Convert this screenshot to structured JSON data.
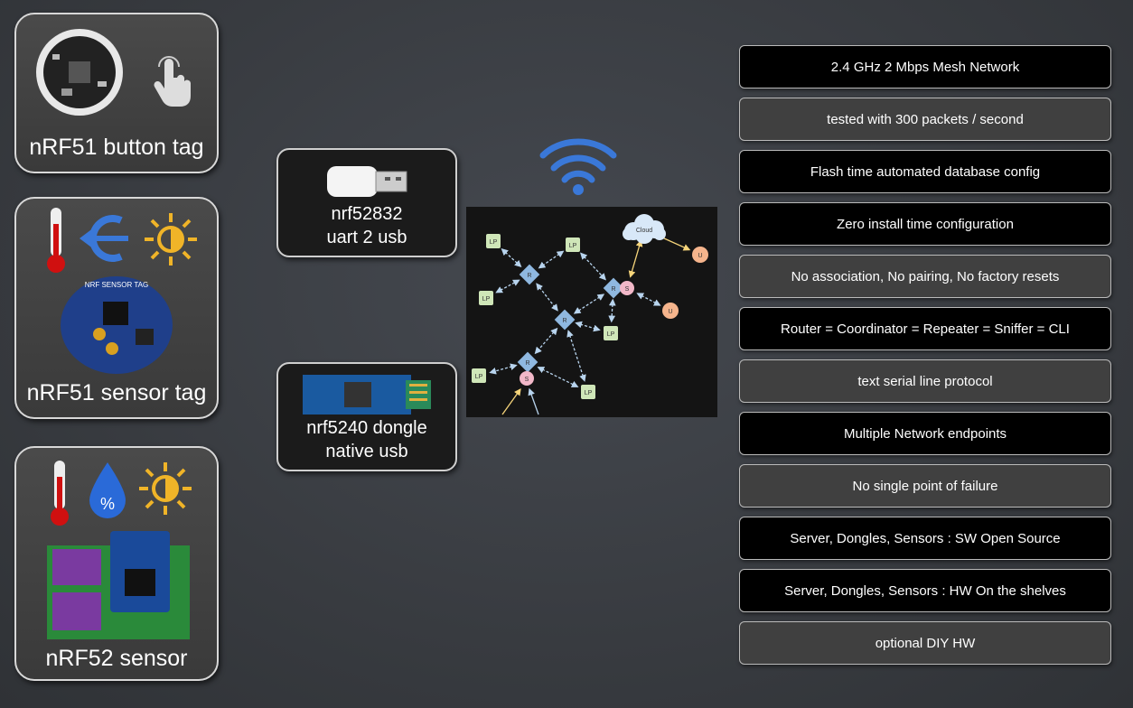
{
  "left_cards": [
    {
      "label": "nRF51 button tag",
      "icons": [
        "circuit-board-photo",
        "touch-hand-icon"
      ]
    },
    {
      "label": "nRF51 sensor tag",
      "icons": [
        "thermometer-icon",
        "rotation-arrow-icon",
        "light-sun-icon",
        "sensor-tag-photo"
      ],
      "board_text": "NRF SENSOR TAG"
    },
    {
      "label": "nRF52 sensor",
      "icons": [
        "thermometer-icon",
        "humidity-drop-icon",
        "light-sun-icon",
        "sensor-board-photo"
      ],
      "drop_text": "%"
    }
  ],
  "devices": [
    {
      "line1": "nrf52832",
      "line2": "uart 2 usb",
      "icon": "usb-stick-icon"
    },
    {
      "line1": "nrf5240 dongle",
      "line2": "native usb",
      "icon": "usb-dongle-photo"
    }
  ],
  "wifi_icon": "wifi-icon",
  "diagram": {
    "cloud_label": "Cloud",
    "router_label": "R",
    "leaf_label": "LP",
    "server_label": "S",
    "user_label": "U"
  },
  "features": [
    {
      "text": "2.4 GHz 2 Mbps Mesh Network",
      "style": "black"
    },
    {
      "text": "tested with 300 packets / second",
      "style": "gray"
    },
    {
      "text": "Flash time automated database config",
      "style": "black"
    },
    {
      "text": "Zero install time configuration",
      "style": "black"
    },
    {
      "text": "No association, No pairing, No factory resets",
      "style": "gray"
    },
    {
      "text": "Router = Coordinator = Repeater = Sniffer = CLI",
      "style": "black"
    },
    {
      "text": "text serial line protocol",
      "style": "gray"
    },
    {
      "text": "Multiple Network endpoints",
      "style": "black"
    },
    {
      "text": "No single point of failure",
      "style": "gray"
    },
    {
      "text": "Server, Dongles, Sensors : SW Open Source",
      "style": "black"
    },
    {
      "text": "Server, Dongles, Sensors : HW On the shelves",
      "style": "black"
    },
    {
      "text": "optional DIY HW",
      "style": "gray"
    }
  ],
  "colors": {
    "leaf": "#cfe6b8",
    "router": "#8fb8e0",
    "user": "#f5b48c",
    "server": "#f2b8c8",
    "link": "#b8d4ee",
    "cloud_link": "#f5d47a",
    "wifi": "#3a78d8"
  }
}
